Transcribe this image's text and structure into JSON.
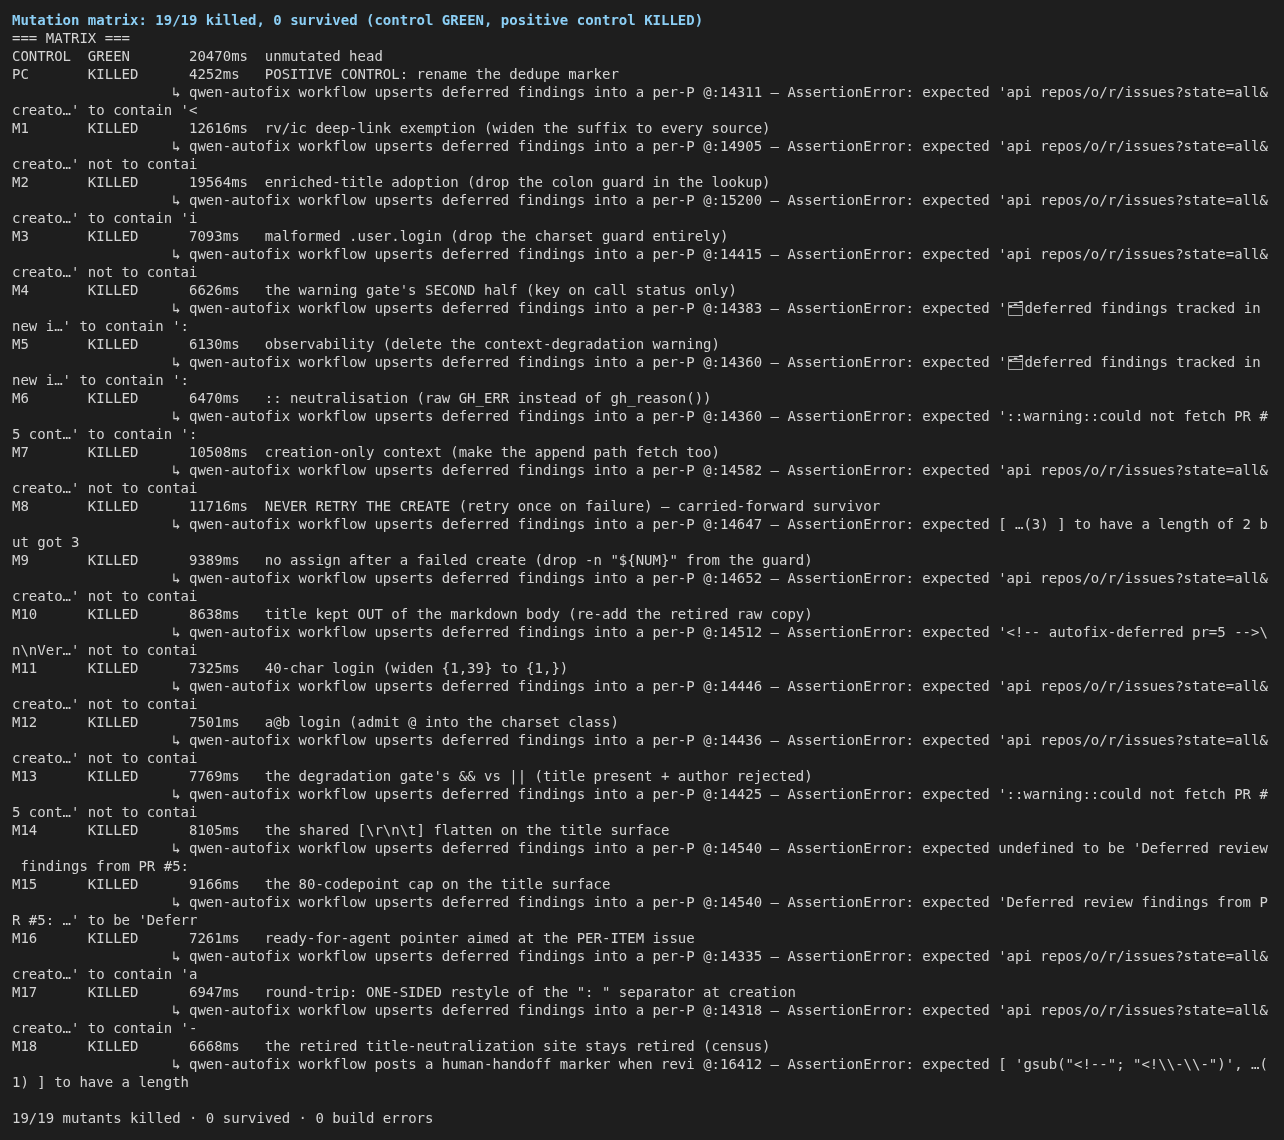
{
  "header": "Mutation matrix: 19/19 killed, 0 survived (control GREEN, positive control KILLED)",
  "section_title": "=== MATRIX ===",
  "rows": [
    {
      "id": "CONTROL",
      "status": "GREEN",
      "time": "20470ms",
      "description": "unmutated head"
    },
    {
      "id": "PC",
      "status": "KILLED",
      "time": "4252ms",
      "description": "POSITIVE CONTROL: rename the dedupe marker",
      "detail": "↳ qwen-autofix workflow upserts deferred findings into a per-P @:14311 — AssertionError: expected 'api repos/o/r/issues?state=all&",
      "detail_wrap": "creato…' to contain '<"
    },
    {
      "id": "M1",
      "status": "KILLED",
      "time": "12616ms",
      "description": "rv/ic deep-link exemption (widen the suffix to every source)",
      "detail": "↳ qwen-autofix workflow upserts deferred findings into a per-P @:14905 — AssertionError: expected 'api repos/o/r/issues?state=all&",
      "detail_wrap": "creato…' not to contai"
    },
    {
      "id": "M2",
      "status": "KILLED",
      "time": "19564ms",
      "description": "enriched-title adoption (drop the colon guard in the lookup)",
      "detail": "↳ qwen-autofix workflow upserts deferred findings into a per-P @:15200 — AssertionError: expected 'api repos/o/r/issues?state=all&",
      "detail_wrap": "creato…' to contain 'i"
    },
    {
      "id": "M3",
      "status": "KILLED",
      "time": "7093ms",
      "description": "malformed .user.login (drop the charset guard entirely)",
      "detail": "↳ qwen-autofix workflow upserts deferred findings into a per-P @:14415 — AssertionError: expected 'api repos/o/r/issues?state=all&",
      "detail_wrap": "creato…' not to contai"
    },
    {
      "id": "M4",
      "status": "KILLED",
      "time": "6626ms",
      "description": "the warning gate's SECOND half (key on call status only)",
      "detail": "↳ qwen-autofix workflow upserts deferred findings into a per-P @:14383 — AssertionError: expected '🗂deferred findings tracked in",
      "detail_wrap": "new i…' to contain ':"
    },
    {
      "id": "M5",
      "status": "KILLED",
      "time": "6130ms",
      "description": "observability (delete the context-degradation warning)",
      "detail": "↳ qwen-autofix workflow upserts deferred findings into a per-P @:14360 — AssertionError: expected '🗂deferred findings tracked in",
      "detail_wrap": "new i…' to contain ':"
    },
    {
      "id": "M6",
      "status": "KILLED",
      "time": "6470ms",
      "description": ":: neutralisation (raw GH_ERR instead of gh_reason())",
      "detail": "↳ qwen-autofix workflow upserts deferred findings into a per-P @:14360 — AssertionError: expected '::warning::could not fetch PR #",
      "detail_wrap": "5 cont…' to contain ':"
    },
    {
      "id": "M7",
      "status": "KILLED",
      "time": "10508ms",
      "description": "creation-only context (make the append path fetch too)",
      "detail": "↳ qwen-autofix workflow upserts deferred findings into a per-P @:14582 — AssertionError: expected 'api repos/o/r/issues?state=all&",
      "detail_wrap": "creato…' not to contai"
    },
    {
      "id": "M8",
      "status": "KILLED",
      "time": "11716ms",
      "description": "NEVER RETRY THE CREATE (retry once on failure) — carried-forward survivor",
      "detail": "↳ qwen-autofix workflow upserts deferred findings into a per-P @:14647 — AssertionError: expected [ …(3) ] to have a length of 2 b",
      "detail_wrap": "ut got 3"
    },
    {
      "id": "M9",
      "status": "KILLED",
      "time": "9389ms",
      "description": "no assign after a failed create (drop -n \"${NUM}\" from the guard)",
      "detail": "↳ qwen-autofix workflow upserts deferred findings into a per-P @:14652 — AssertionError: expected 'api repos/o/r/issues?state=all&",
      "detail_wrap": "creato…' not to contai"
    },
    {
      "id": "M10",
      "status": "KILLED",
      "time": "8638ms",
      "description": "title kept OUT of the markdown body (re-add the retired raw copy)",
      "detail": "↳ qwen-autofix workflow upserts deferred findings into a per-P @:14512 — AssertionError: expected '<!-- autofix-deferred pr=5 -->\\",
      "detail_wrap": "n\\nVer…' not to contai"
    },
    {
      "id": "M11",
      "status": "KILLED",
      "time": "7325ms",
      "description": "40-char login (widen {1,39} to {1,})",
      "detail": "↳ qwen-autofix workflow upserts deferred findings into a per-P @:14446 — AssertionError: expected 'api repos/o/r/issues?state=all&",
      "detail_wrap": "creato…' not to contai"
    },
    {
      "id": "M12",
      "status": "KILLED",
      "time": "7501ms",
      "description": "a@b login (admit @ into the charset class)",
      "detail": "↳ qwen-autofix workflow upserts deferred findings into a per-P @:14436 — AssertionError: expected 'api repos/o/r/issues?state=all&",
      "detail_wrap": "creato…' not to contai"
    },
    {
      "id": "M13",
      "status": "KILLED",
      "time": "7769ms",
      "description": "the degradation gate's && vs || (title present + author rejected)",
      "detail": "↳ qwen-autofix workflow upserts deferred findings into a per-P @:14425 — AssertionError: expected '::warning::could not fetch PR #",
      "detail_wrap": "5 cont…' not to contai"
    },
    {
      "id": "M14",
      "status": "KILLED",
      "time": "8105ms",
      "description": "the shared [\\r\\n\\t] flatten on the title surface",
      "detail": "↳ qwen-autofix workflow upserts deferred findings into a per-P @:14540 — AssertionError: expected undefined to be 'Deferred review",
      "detail_wrap": " findings from PR #5:"
    },
    {
      "id": "M15",
      "status": "KILLED",
      "time": "9166ms",
      "description": "the 80-codepoint cap on the title surface",
      "detail": "↳ qwen-autofix workflow upserts deferred findings into a per-P @:14540 — AssertionError: expected 'Deferred review findings from P",
      "detail_wrap": "R #5: …' to be 'Deferr"
    },
    {
      "id": "M16",
      "status": "KILLED",
      "time": "7261ms",
      "description": "ready-for-agent pointer aimed at the PER-ITEM issue",
      "detail": "↳ qwen-autofix workflow upserts deferred findings into a per-P @:14335 — AssertionError: expected 'api repos/o/r/issues?state=all&",
      "detail_wrap": "creato…' to contain 'a"
    },
    {
      "id": "M17",
      "status": "KILLED",
      "time": "6947ms",
      "description": "round-trip: ONE-SIDED restyle of the \": \" separator at creation",
      "detail": "↳ qwen-autofix workflow upserts deferred findings into a per-P @:14318 — AssertionError: expected 'api repos/o/r/issues?state=all&",
      "detail_wrap": "creato…' to contain '-"
    },
    {
      "id": "M18",
      "status": "KILLED",
      "time": "6668ms",
      "description": "the retired title-neutralization site stays retired (census)",
      "detail": "↳ qwen-autofix workflow posts a human-handoff marker when revi @:16412 — AssertionError: expected [ 'gsub(\"<!--\"; \"<!\\\\-\\\\-\")', …(",
      "detail_wrap": "1) ] to have a length"
    }
  ],
  "summary": "19/19 mutants killed · 0 survived · 0 build errors"
}
